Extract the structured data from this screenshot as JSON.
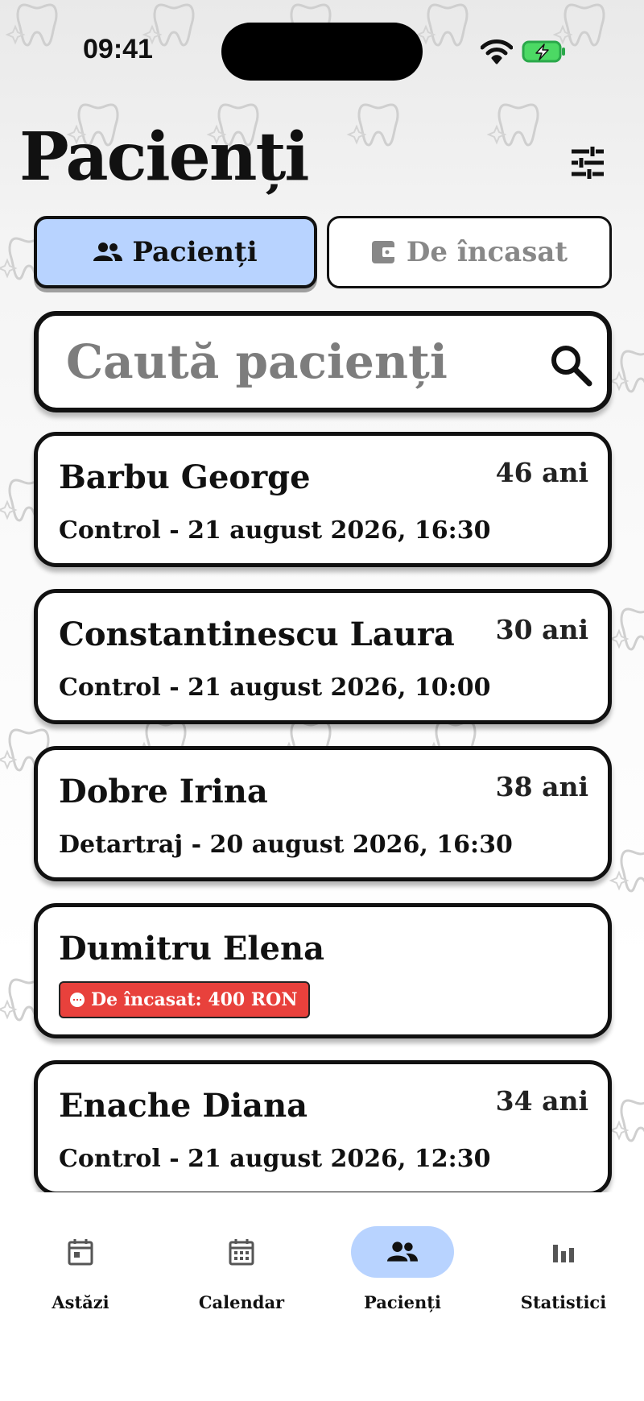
{
  "status_bar": {
    "time": "09:41",
    "wifi_icon": "wifi-icon",
    "battery_icon": "battery-charging-icon",
    "battery_color": "#4cd964"
  },
  "header": {
    "title": "Pacienți",
    "filter_icon": "sliders-icon"
  },
  "tabs": [
    {
      "label": "Pacienți",
      "icon": "people-icon",
      "active": true
    },
    {
      "label": "De încasat",
      "icon": "wallet-icon",
      "active": false
    }
  ],
  "search": {
    "placeholder": "Caută pacienți",
    "value": "",
    "icon": "search-icon"
  },
  "patients": [
    {
      "name": "Barbu George",
      "age": "46 ani",
      "appointment": "Control - 21 august 2026, 16:30"
    },
    {
      "name": "Constantinescu Laura",
      "age": "30 ani",
      "appointment": "Control - 21 august 2026, 10:00"
    },
    {
      "name": "Dobre Irina",
      "age": "38 ani",
      "appointment": "Detartraj - 20 august 2026, 16:30"
    },
    {
      "name": "Dumitru Elena",
      "due": "De încasat: 400 RON"
    },
    {
      "name": "Enache Diana",
      "age": "34 ani",
      "appointment": "Control - 21 august 2026, 12:30"
    }
  ],
  "bottom_nav": [
    {
      "label": "Astăzi",
      "icon": "calendar-today-icon",
      "active": false
    },
    {
      "label": "Calendar",
      "icon": "calendar-month-icon",
      "active": false
    },
    {
      "label": "Pacienți",
      "icon": "people-icon",
      "active": true
    },
    {
      "label": "Statistici",
      "icon": "bar-chart-icon",
      "active": false
    }
  ],
  "colors": {
    "accent": "#b8d3ff",
    "due_badge": "#e8413c",
    "text": "#111111",
    "placeholder": "#7d7d7d"
  }
}
